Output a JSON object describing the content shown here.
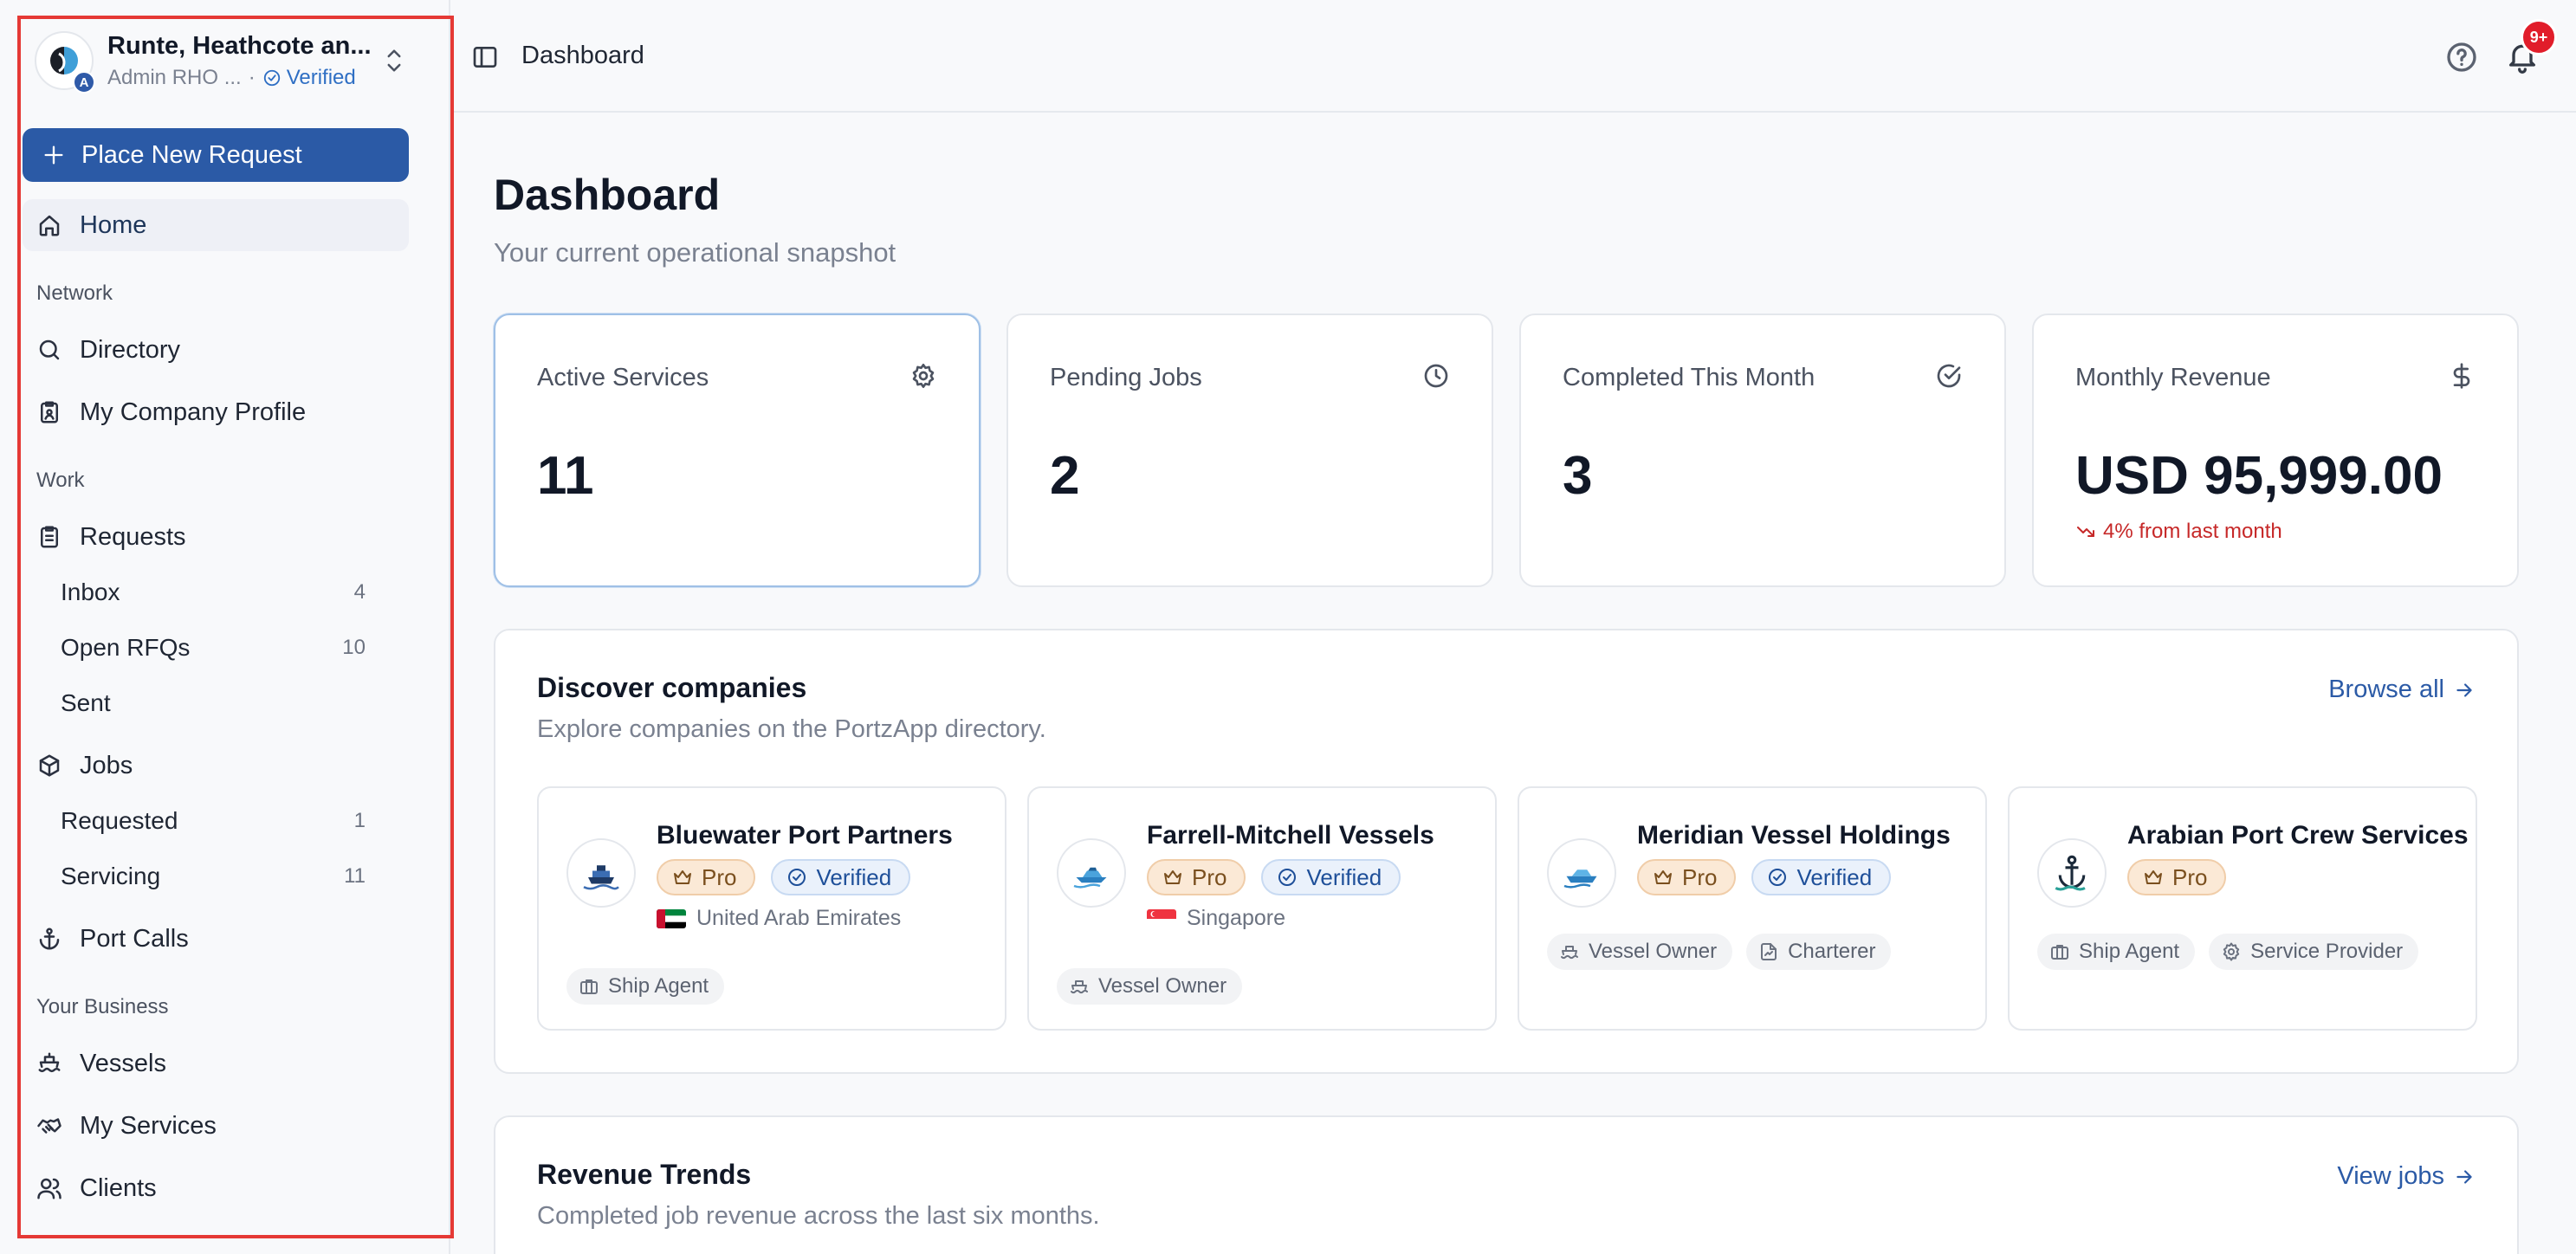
{
  "org": {
    "name": "Runte, Heathcote an...",
    "role": "Admin RHO ...",
    "separator": "·",
    "verified": "Verified",
    "badge": "A"
  },
  "sidebar": {
    "cta": "Place New Request",
    "home": "Home",
    "sections": {
      "network": "Network",
      "work": "Work",
      "business": "Your Business"
    },
    "directory": "Directory",
    "company_profile": "My Company Profile",
    "requests": "Requests",
    "inbox": {
      "label": "Inbox",
      "count": "4"
    },
    "open_rfqs": {
      "label": "Open RFQs",
      "count": "10"
    },
    "sent": {
      "label": "Sent"
    },
    "jobs": "Jobs",
    "requested": {
      "label": "Requested",
      "count": "1"
    },
    "servicing": {
      "label": "Servicing",
      "count": "11"
    },
    "port_calls": "Port Calls",
    "vessels": "Vessels",
    "my_services": "My Services",
    "clients": "Clients"
  },
  "topbar": {
    "title": "Dashboard",
    "notification_count": "9+"
  },
  "main": {
    "title": "Dashboard",
    "subtitle": "Your current operational snapshot",
    "stats": [
      {
        "label": "Active Services",
        "value": "11",
        "icon": "gear-icon"
      },
      {
        "label": "Pending Jobs",
        "value": "2",
        "icon": "clock-icon"
      },
      {
        "label": "Completed This Month",
        "value": "3",
        "icon": "check-circle-icon"
      },
      {
        "label": "Monthly Revenue",
        "value": "USD 95,999.00",
        "icon": "dollar-icon",
        "trend": "4% from last month"
      }
    ],
    "discover": {
      "title": "Discover companies",
      "subtitle": "Explore companies on the PortzApp directory.",
      "link": "Browse all",
      "companies": [
        {
          "name": "Bluewater Port Partners",
          "pro": "Pro",
          "verified": "Verified",
          "country": "United Arab Emirates",
          "tags": [
            "Ship Agent"
          ]
        },
        {
          "name": "Farrell-Mitchell Vessels",
          "pro": "Pro",
          "verified": "Verified",
          "country": "Singapore",
          "tags": [
            "Vessel Owner"
          ]
        },
        {
          "name": "Meridian Vessel Holdings",
          "pro": "Pro",
          "verified": "Verified",
          "tags": [
            "Vessel Owner",
            "Charterer"
          ]
        },
        {
          "name": "Arabian Port Crew Services",
          "pro": "Pro",
          "tags": [
            "Ship Agent",
            "Service Provider"
          ]
        }
      ]
    },
    "revenue": {
      "title": "Revenue Trends",
      "subtitle": "Completed job revenue across the last six months.",
      "link": "View jobs"
    }
  },
  "colors": {
    "primary": "#2b5aa6",
    "danger": "#e11d2a",
    "pro_bg": "#fbe9d6",
    "verified_bg": "#eaf1fb"
  }
}
